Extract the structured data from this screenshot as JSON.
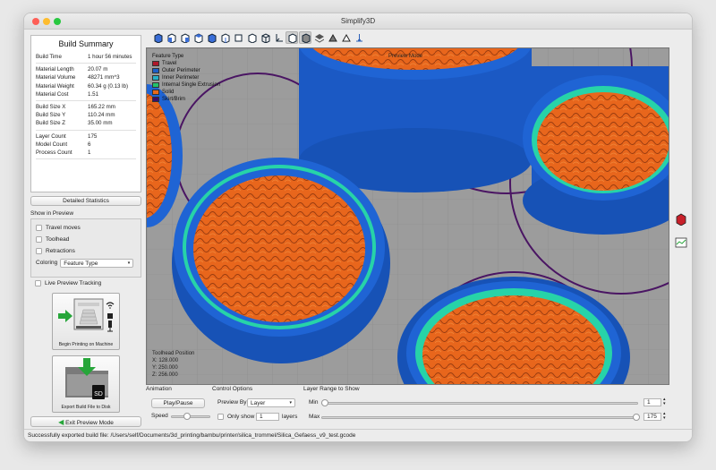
{
  "window": {
    "title": "Simplify3D"
  },
  "summary": {
    "title": "Build Summary",
    "rows1": [
      {
        "k": "Build Time",
        "v": "1 hour 56 minutes"
      }
    ],
    "rows2": [
      {
        "k": "Material Length",
        "v": "20.07 m"
      },
      {
        "k": "Material Volume",
        "v": "48271 mm^3"
      },
      {
        "k": "Material Weight",
        "v": "60.34 g (0.13 lb)"
      },
      {
        "k": "Material Cost",
        "v": "1.51"
      }
    ],
    "rows3": [
      {
        "k": "Build Size X",
        "v": "165.22 mm"
      },
      {
        "k": "Build Size Y",
        "v": "110.24 mm"
      },
      {
        "k": "Build Size Z",
        "v": "35.00 mm"
      }
    ],
    "rows4": [
      {
        "k": "Layer Count",
        "v": "175"
      },
      {
        "k": "Model Count",
        "v": "6"
      },
      {
        "k": "Process Count",
        "v": "1"
      }
    ],
    "detailed_label": "Detailed Statistics"
  },
  "preview": {
    "group_label": "Show in Preview",
    "travel": "Travel moves",
    "toolhead": "Toolhead",
    "retractions": "Retractions",
    "coloring_label": "Coloring",
    "coloring_value": "Feature Type",
    "live": "Live Preview Tracking"
  },
  "actions": {
    "begin_printing": "Begin Printing on Machine",
    "export": "Export Build File to Disk",
    "exit": "Exit Preview Mode"
  },
  "viewport": {
    "legend_title": "Feature Type",
    "legend": [
      {
        "label": "Travel",
        "color": "#b0182a"
      },
      {
        "label": "Outer Perimeter",
        "color": "#1d5fc8"
      },
      {
        "label": "Inner Perimeter",
        "color": "#27b0c8"
      },
      {
        "label": "Internal Single Extrusion",
        "color": "#23c26a"
      },
      {
        "label": "Solid",
        "color": "#e86a1c"
      },
      {
        "label": "Skirt/Brim",
        "color": "#3a0f6a"
      }
    ],
    "preview_mode": "Preview Mode",
    "toolhead_title": "Toolhead Position",
    "x": "X: 128.000",
    "y": "Y: 250.000",
    "z": "Z: 256.000"
  },
  "animation": {
    "label": "Animation",
    "play": "Play/Pause",
    "speed": "Speed"
  },
  "control": {
    "label": "Control Options",
    "preview_by": "Preview By",
    "preview_by_value": "Layer",
    "only_show": "Only show",
    "only_show_value": "1",
    "layers": "layers"
  },
  "range": {
    "label": "Layer Range to Show",
    "min_label": "Min",
    "min_value": "1",
    "max_label": "Max",
    "max_value": "175"
  },
  "status": "Successfully exported build file: /Users/self/Documents/3d_printing/bambu/printer/silica_trommel/Silica_Gefaess_v9_test.gcode"
}
